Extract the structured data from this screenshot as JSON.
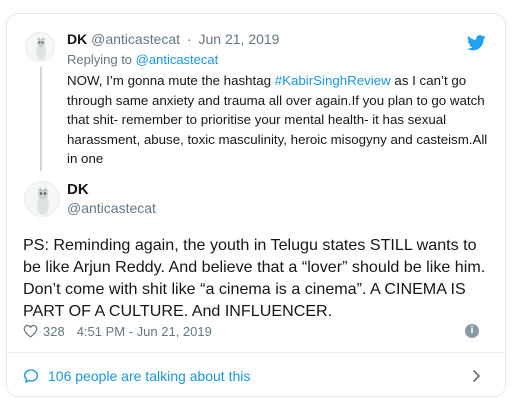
{
  "parent": {
    "name": "DK",
    "handle": "@anticastecat",
    "separator": "·",
    "date": "Jun 21, 2019",
    "reply_prefix": "Replying to",
    "reply_to": "@anticastecat",
    "text_before": "NOW, I’m gonna mute the hashtag ",
    "hashtag": "#KabirSinghReview",
    "text_after": " as I can’t go through same anxiety and trauma all over again.If you plan to go watch that shit- remember to prioritise your mental health- it has sexual harassment, abuse, toxic masculinity, heroic misogyny and casteism.All in one"
  },
  "tweet": {
    "name": "DK",
    "handle": "@anticastecat",
    "text": "PS: Reminding again, the youth in Telugu states STILL wants to be like Arjun Reddy. And believe that a “lover” should be like him. Don’t come with shit like “a cinema is a cinema”. A CINEMA IS PART OF A CULTURE. And INFLUENCER.",
    "likes": "328",
    "timestamp": "4:51 PM - Jun 21, 2019"
  },
  "footer": {
    "talking": "106 people are talking about this"
  },
  "icons": {
    "brand": "twitter-bird-icon",
    "like": "heart-icon",
    "info": "info-icon",
    "talk": "speech-bubble-icon",
    "chevron": "chevron-right-icon"
  },
  "colors": {
    "link": "#1b95e0",
    "muted": "#657786",
    "text": "#14171a",
    "border": "#e1e8ed"
  }
}
